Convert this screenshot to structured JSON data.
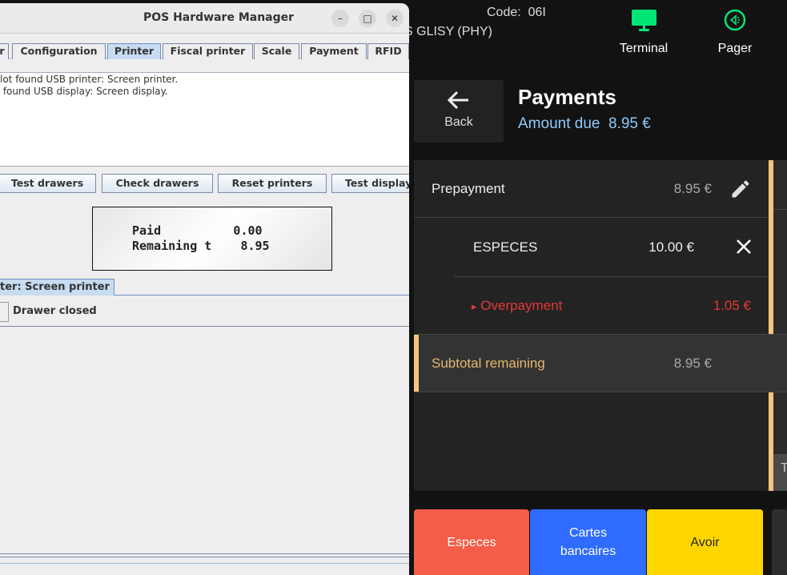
{
  "pos": {
    "code_label": "Code:  06I",
    "store_name": "S GLISY (PHY)",
    "terminal_label": "Terminal",
    "pager_label": "Pager",
    "back_label": "Back",
    "title": "Payments",
    "amount_due_label": "Amount due  8.95 €",
    "rows": {
      "prepayment": {
        "label": "Prepayment",
        "amount": "8.95 €"
      },
      "especes": {
        "label": "ESPECES",
        "amount": "10.00 €"
      },
      "overpayment": {
        "marker": "▸",
        "label": "Overpayment",
        "amount": "1.05 €"
      },
      "subtotal": {
        "label": "Subtotal remaining",
        "amount": "8.95 €"
      }
    },
    "side_letter": "T",
    "methods": {
      "especes": "Especes",
      "cartes": "Cartes\nbancaires",
      "avoir": "Avoir"
    },
    "colors": {
      "accent_green": "#00e676",
      "orange": "#f5c57f",
      "red": "#e53935",
      "especes": "#f45d48",
      "cartes": "#2f6bff",
      "avoir": "#ffd600"
    }
  },
  "hw": {
    "title": "POS Hardware Manager",
    "tabs": [
      "r",
      "Configuration",
      "Printer",
      "Fiscal printer",
      "Scale",
      "Payment",
      "RFID"
    ],
    "log": "lot found USB printer: Screen printer.\n found USB display: Screen display.",
    "buttons": [
      "Test drawers",
      "Check drawers",
      "Reset printers",
      "Test display"
    ],
    "display": {
      "line1": "Paid          0.00",
      "line2": "Remaining t    8.95"
    },
    "printer_tab": "ter: Screen printer",
    "drawer_status": "Drawer closed"
  }
}
